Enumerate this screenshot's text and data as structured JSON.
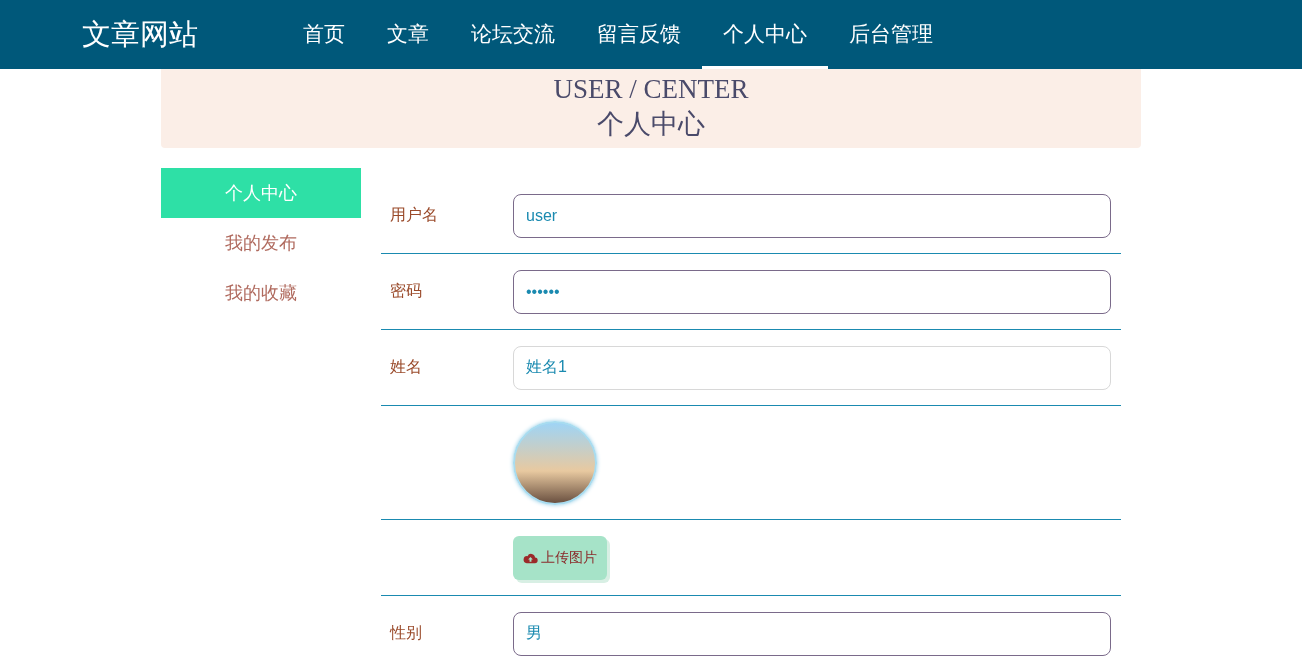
{
  "site_title": "文章网站",
  "nav": [
    {
      "label": "首页",
      "selected": false
    },
    {
      "label": "文章",
      "selected": false
    },
    {
      "label": "论坛交流",
      "selected": false
    },
    {
      "label": "留言反馈",
      "selected": false
    },
    {
      "label": "个人中心",
      "selected": true
    },
    {
      "label": "后台管理",
      "selected": false
    }
  ],
  "banner": {
    "title": "USER / CENTER",
    "subtitle": "个人中心"
  },
  "sidebar": {
    "items": [
      {
        "label": "个人中心",
        "selected": true
      },
      {
        "label": "我的发布",
        "selected": false
      },
      {
        "label": "我的收藏",
        "selected": false
      }
    ]
  },
  "form": {
    "rows": [
      {
        "kind": "text",
        "label": "用户名",
        "value": "user",
        "disabled": false
      },
      {
        "kind": "password",
        "label": "密码",
        "value": "••••••",
        "disabled": false
      },
      {
        "kind": "text",
        "label": "姓名",
        "value": "姓名1",
        "disabled": true
      },
      {
        "kind": "avatar"
      },
      {
        "kind": "upload",
        "button": "上传图片"
      },
      {
        "kind": "text",
        "label": "性别",
        "value": "男",
        "disabled": false
      }
    ]
  }
}
